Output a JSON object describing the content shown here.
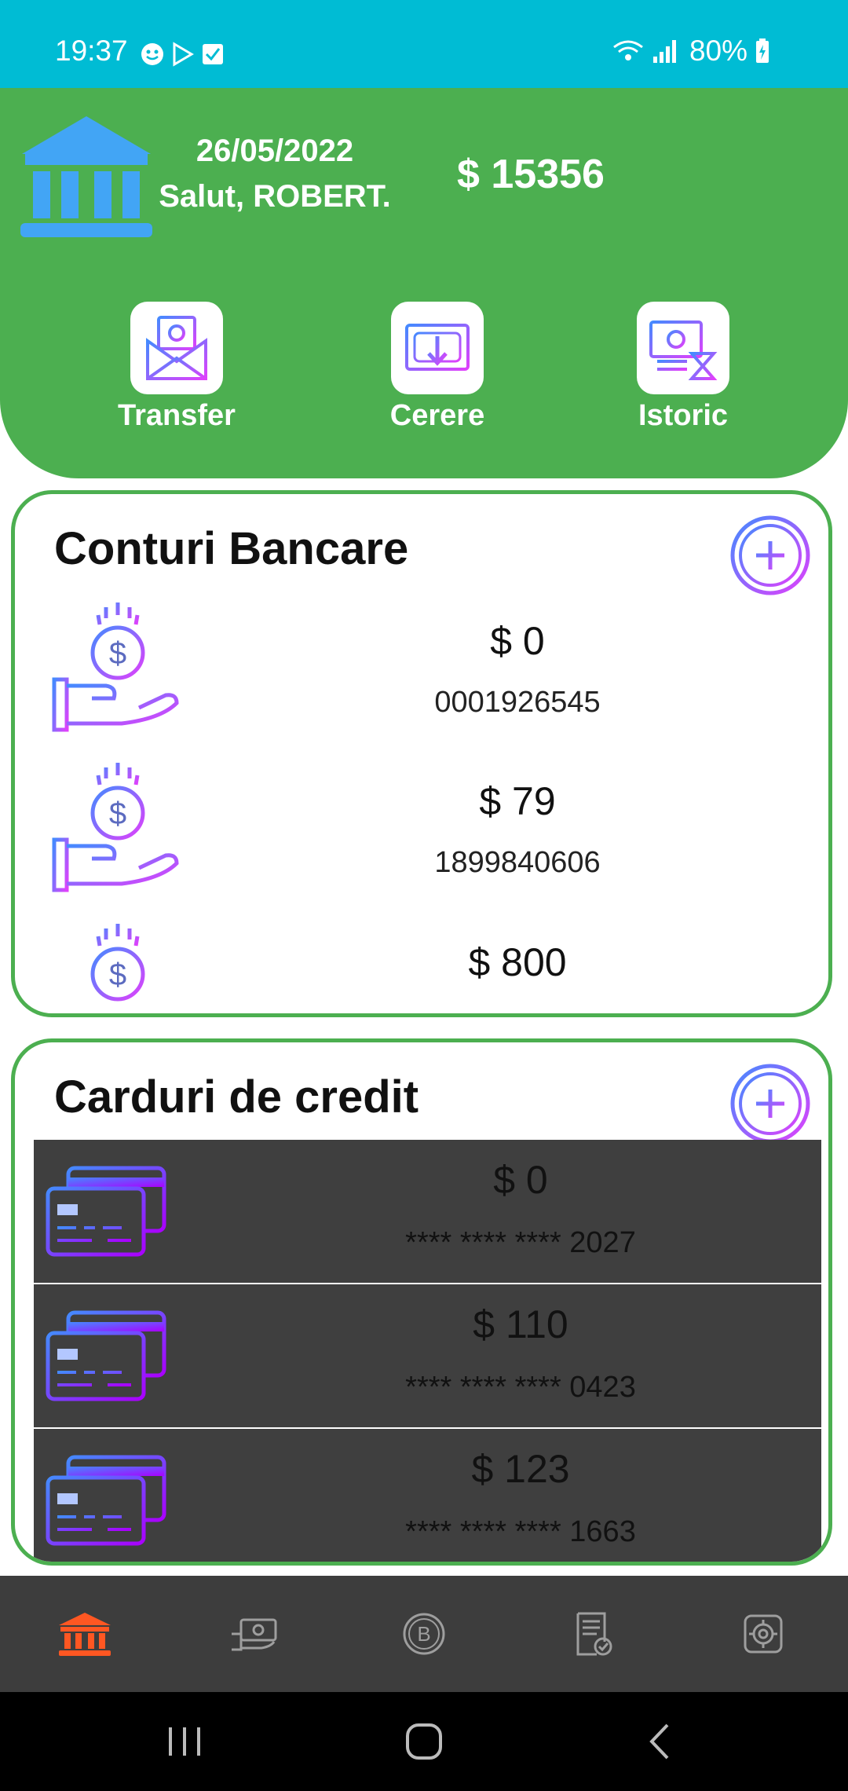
{
  "status_bar": {
    "time": "19:37",
    "battery": "80%"
  },
  "header": {
    "date": "26/05/2022",
    "greeting": "Salut, ROBERT.",
    "balance": "$ 15356",
    "actions": [
      {
        "label": "Transfer",
        "icon": "money-envelope-icon"
      },
      {
        "label": "Cerere",
        "icon": "money-request-icon"
      },
      {
        "label": "Istoric",
        "icon": "money-history-icon"
      }
    ]
  },
  "bank_accounts": {
    "title": "Conturi Bancare",
    "items": [
      {
        "amount": "$ 0",
        "number": "0001926545"
      },
      {
        "amount": "$ 79",
        "number": "1899840606"
      },
      {
        "amount": "$ 800",
        "number": ""
      }
    ]
  },
  "credit_cards": {
    "title": "Carduri de credit",
    "items": [
      {
        "amount": "$ 0",
        "number": "**** **** **** 2027"
      },
      {
        "amount": "$ 110",
        "number": "**** **** **** 0423"
      },
      {
        "amount": "$ 123",
        "number": "**** **** **** 1663"
      }
    ]
  },
  "bottom_nav": [
    {
      "icon": "bank-icon",
      "active": true
    },
    {
      "icon": "cash-hand-icon",
      "active": false
    },
    {
      "icon": "bitcoin-icon",
      "active": false
    },
    {
      "icon": "receipt-icon",
      "active": false
    },
    {
      "icon": "settings-icon",
      "active": false
    }
  ],
  "colors": {
    "status_bar": "#00BCD4",
    "header": "#4CAF50",
    "accent_active": "#FF5722",
    "card_row": "#3f3f3f",
    "bottom_nav": "#3d3d3d"
  }
}
